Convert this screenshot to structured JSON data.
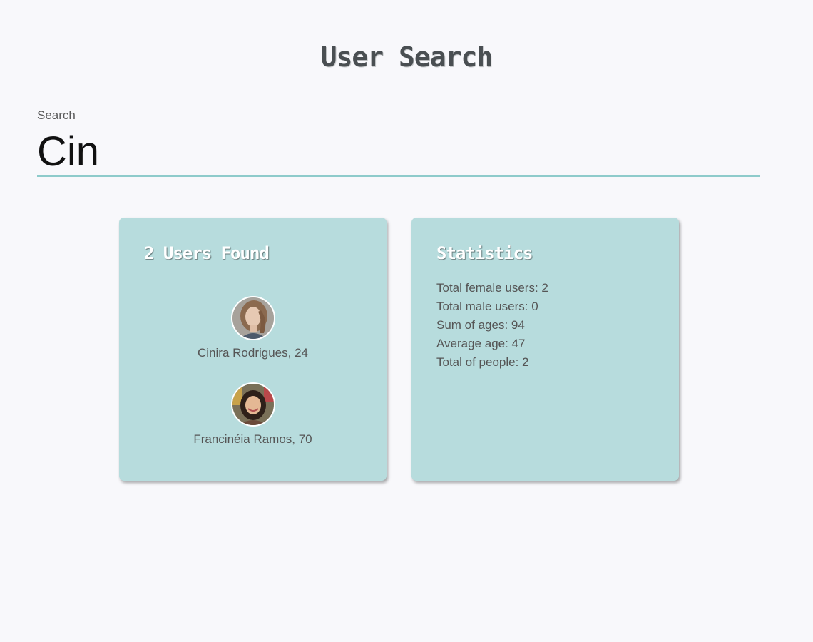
{
  "page": {
    "title": "User Search"
  },
  "search": {
    "label": "Search",
    "value": "Cin"
  },
  "users_card": {
    "title": "2 Users Found",
    "users": [
      {
        "name": "Cinira Rodrigues, 24",
        "avatar_icon": "user-avatar-photo"
      },
      {
        "name": "Francinéia Ramos, 70",
        "avatar_icon": "user-avatar-photo"
      }
    ]
  },
  "stats_card": {
    "title": "Statistics",
    "lines": [
      "Total female users: 2",
      "Total male users: 0",
      "Sum of ages: 94",
      "Average age: 47",
      "Total of people: 2"
    ]
  },
  "colors": {
    "background": "#f8f8fb",
    "card": "#b7dcdd",
    "accent_underline": "#8ecbcb",
    "card_title": "#ffffff"
  }
}
